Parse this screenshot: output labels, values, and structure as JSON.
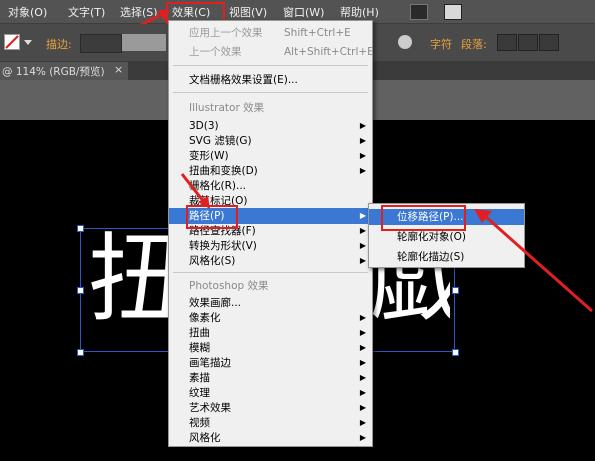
{
  "menubar": {
    "items": [
      "对象(O)",
      "文字(T)",
      "选择(S)",
      "效果(C)",
      "视图(V)",
      "窗口(W)",
      "帮助(H)"
    ],
    "right_icons": [
      "Ai-icon",
      "layout-icon"
    ]
  },
  "toolbar": {
    "stroke_label": "描边:",
    "char_label": "字符",
    "para_label": "段落:"
  },
  "doc_tab": {
    "title": "@ 114% (RGB/预览)",
    "close": "×"
  },
  "effect_menu": {
    "apply_last": "应用上一个效果",
    "apply_last_shortcut": "Shift+Ctrl+E",
    "last_effect": "上一个效果",
    "last_effect_shortcut": "Alt+Shift+Ctrl+E",
    "doc_raster": "文档栅格效果设置(E)...",
    "illustrator_header": "Illustrator 效果",
    "illustrator_items": [
      "3D(3)",
      "SVG 滤镜(G)",
      "变形(W)",
      "扭曲和变换(D)",
      "栅格化(R)...",
      "裁剪标记(O)",
      "路径(P)",
      "路径查找器(F)",
      "转换为形状(V)",
      "风格化(S)"
    ],
    "photoshop_header": "Photoshop 效果",
    "photoshop_items": [
      "效果画廊...",
      "像素化",
      "扭曲",
      "模糊",
      "画笔描边",
      "素描",
      "纹理",
      "艺术效果",
      "视频",
      "风格化"
    ]
  },
  "path_submenu": {
    "items": [
      "位移路径(P)...",
      "轮廓化对象(O)",
      "轮廓化描边(S)"
    ]
  },
  "canvas_text": {
    "left_glyph": "扭",
    "right_glyph": "戯"
  },
  "colors": {
    "highlight": "#3a78d4",
    "annotation": "#e02020",
    "menu_bg": "#f0f0f0"
  }
}
